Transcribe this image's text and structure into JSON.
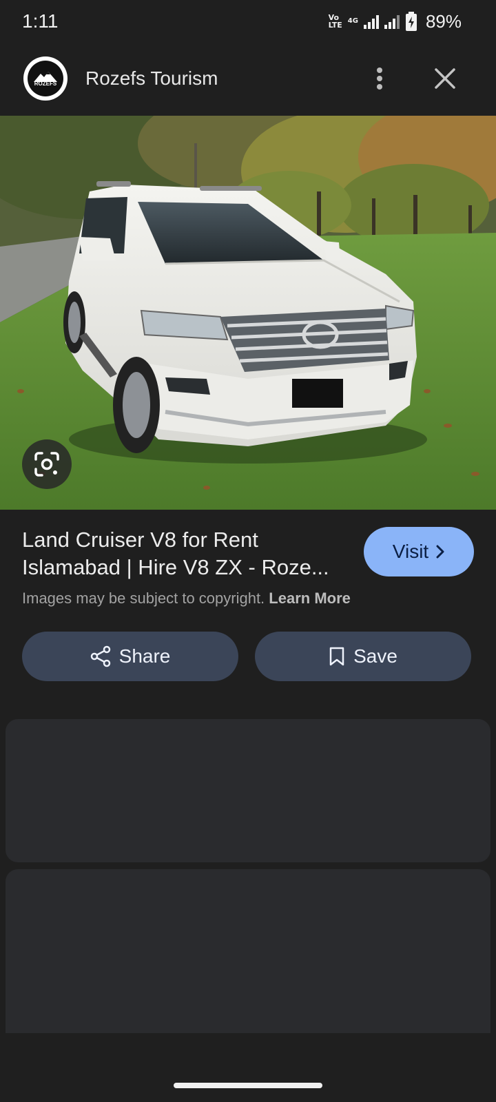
{
  "status_bar": {
    "time": "1:11",
    "network_volte": "VoLTE2",
    "network_type": "4G",
    "battery": "89%"
  },
  "header": {
    "site_name": "Rozefs Tourism",
    "logo_text": "ROZEFS",
    "more_icon": "more-vert-icon",
    "close_icon": "close-icon"
  },
  "image": {
    "lens_icon": "google-lens-icon"
  },
  "result": {
    "title_line1": "Land Cruiser V8 for Rent",
    "title_line2": "Islamabad | Hire V8 ZX - Roze...",
    "visit_label": "Visit",
    "copyright_text": "Images may be subject to copyright.",
    "learn_more": "Learn More"
  },
  "actions": {
    "share_label": "Share",
    "save_label": "Save"
  },
  "colors": {
    "background": "#1f1f1f",
    "visit_button": "#8ab4f8",
    "pill_button": "#3b4558",
    "card": "#2a2b2e"
  }
}
